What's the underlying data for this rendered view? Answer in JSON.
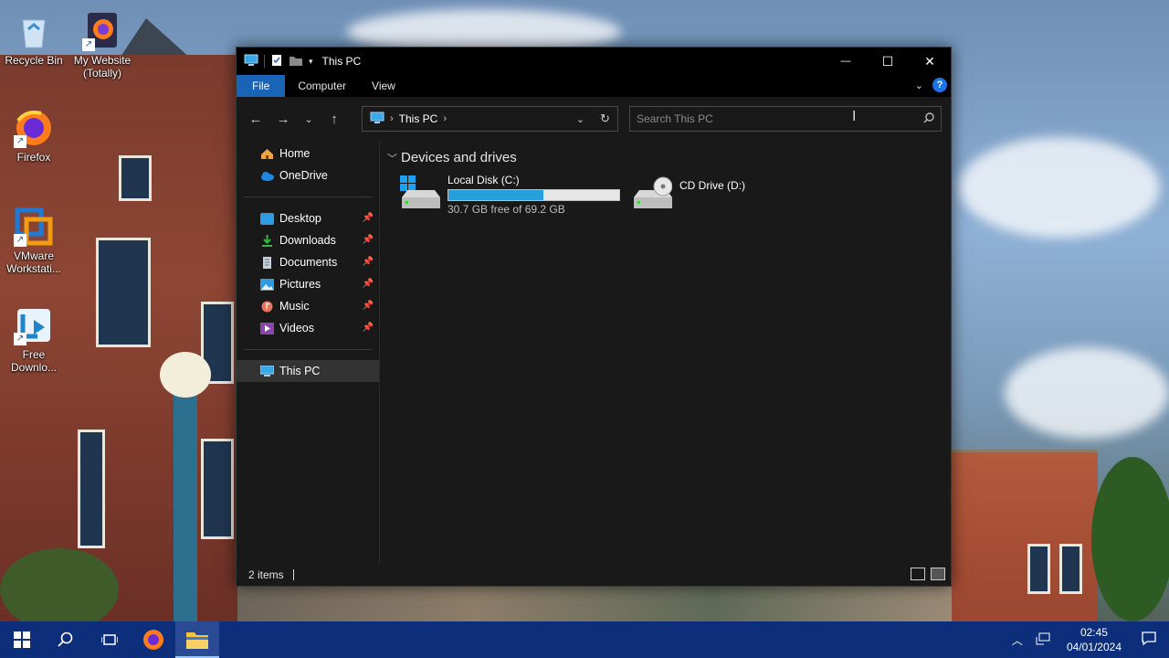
{
  "desktop": {
    "icons": [
      {
        "label": "Recycle Bin",
        "icon": "recycle-bin-icon"
      },
      {
        "label": "My Website (Totally)",
        "icon": "firefox-shortcut-icon"
      },
      {
        "label": "Firefox",
        "icon": "firefox-icon"
      },
      {
        "label": "VMware Workstati...",
        "icon": "vmware-icon"
      },
      {
        "label": "Free Downlo...",
        "icon": "free-download-manager-icon"
      }
    ]
  },
  "window": {
    "title": "This PC",
    "controls": {
      "minimize": "—",
      "maximize": "☐",
      "close": "✕"
    },
    "ribbon": {
      "tabs": [
        "File",
        "Computer",
        "View"
      ]
    },
    "address": {
      "location": "This PC"
    },
    "search": {
      "placeholder": "Search This PC"
    },
    "nav": {
      "home": "Home",
      "onedrive": "OneDrive",
      "quick": [
        "Desktop",
        "Downloads",
        "Documents",
        "Pictures",
        "Music",
        "Videos"
      ],
      "thispc": "This PC"
    },
    "group": {
      "title": "Devices and drives"
    },
    "drives": [
      {
        "name": "Local Disk (C:)",
        "free_text": "30.7 GB free of 69.2 GB",
        "used_fraction": 0.556
      },
      {
        "name": "CD Drive (D:)"
      }
    ],
    "status": {
      "items": "2 items"
    }
  },
  "taskbar": {
    "clock": {
      "time": "02:45",
      "date": "04/01/2024"
    }
  }
}
